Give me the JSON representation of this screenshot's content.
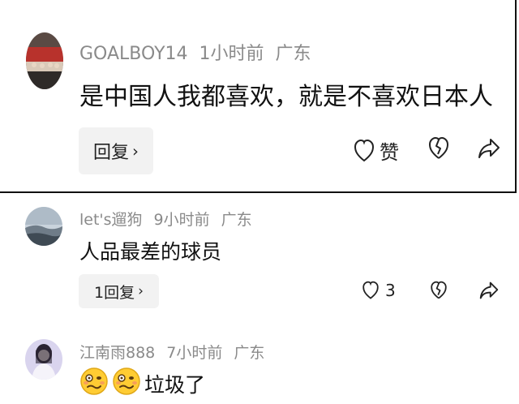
{
  "comments": [
    {
      "username": "GOALBOY14",
      "time": "1小时前",
      "location": "广东",
      "text": "是中国人我都喜欢，就是不喜欢日本人",
      "reply_label": "回复",
      "like_label": "赞",
      "avatar_icon": "group-photo-avatar"
    },
    {
      "username": "let's遛狗",
      "time": "9小时前",
      "location": "广东",
      "text": "人品最差的球员",
      "reply_label": "1回复",
      "like_count": "3",
      "avatar_icon": "landscape-avatar"
    },
    {
      "username": "江南雨888",
      "time": "7小时前",
      "location": "广东",
      "text": "垃圾了",
      "avatar_icon": "portrait-avatar",
      "emojis": [
        "woozy-face-emoji",
        "woozy-face-emoji"
      ]
    }
  ],
  "chevron": "›",
  "colors": {
    "meta": "#8a8a8a",
    "text": "#111111",
    "button_bg": "#f2f2f2"
  }
}
